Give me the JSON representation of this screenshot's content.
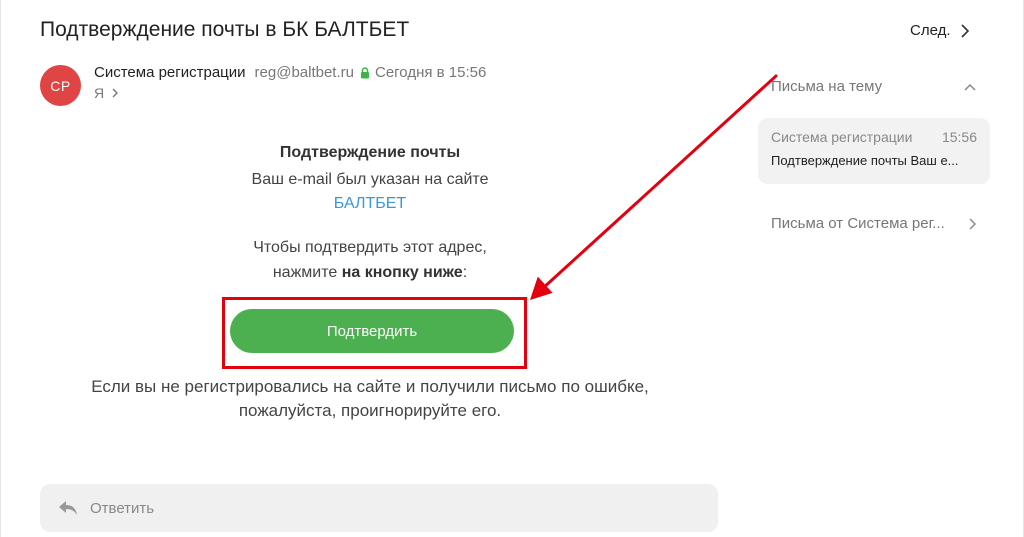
{
  "message": {
    "subject": "Подтверждение почты в БК БАЛТБЕТ",
    "next_label": "След.",
    "avatar_initials": "СР",
    "sender_name": "Система регистрации",
    "sender_email": "reg@baltbet.ru",
    "sent_time": "Сегодня в 15:56",
    "recipient": "Я"
  },
  "body": {
    "title": "Подтверждение почты",
    "line1": "Ваш e-mail был указан на сайте",
    "site_name": "БАЛТБЕТ",
    "instruction_line1": "Чтобы подтвердить этот адрес,",
    "instruction_prefix": "нажмите ",
    "instruction_bold": "на кнопку ниже",
    "instruction_suffix": ":",
    "confirm_button": "Подтвердить",
    "ignore_line1": "Если вы не регистрировались на сайте и получили письмо по ошибке,",
    "ignore_line2": "пожалуйста, проигнорируйте его."
  },
  "reply": {
    "label": "Ответить"
  },
  "sidebar": {
    "thread_title": "Письма на тему",
    "thread_items": [
      {
        "sender": "Система регистрации",
        "time": "15:56",
        "subject": "Подтверждение почты Ваш е..."
      }
    ],
    "from_sender_label": "Письма от Система рег..."
  },
  "colors": {
    "avatar_bg": "#e04545",
    "confirm_button": "#4caf50",
    "link": "#3a97d9",
    "secure_lock": "#3bb54a",
    "annotation_red": "#e3000f"
  },
  "icons": {
    "next": "chevron-right-icon",
    "secure": "lock-icon",
    "recipient_expand": "chevron-right-icon",
    "reply": "reply-arrow-icon",
    "thread_collapse": "chevron-up-icon",
    "from_sender": "chevron-right-icon"
  }
}
